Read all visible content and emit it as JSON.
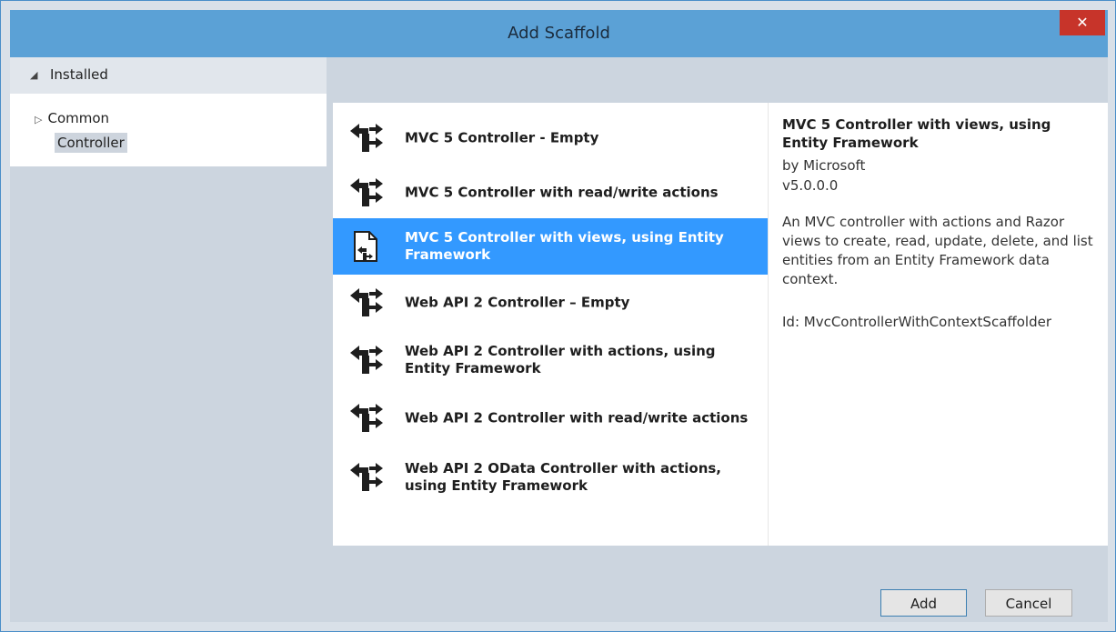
{
  "window": {
    "title": "Add Scaffold",
    "close_glyph": "✕"
  },
  "tree": {
    "header": "Installed",
    "common": "Common",
    "controller": "Controller"
  },
  "scaffolds": [
    {
      "label": "MVC 5 Controller - Empty",
      "icon": "controller-icon"
    },
    {
      "label": "MVC 5 Controller with read/write actions",
      "icon": "controller-icon"
    },
    {
      "label": "MVC 5 Controller with views, using Entity Framework",
      "icon": "controller-views-icon",
      "selected": true
    },
    {
      "label": "Web API 2 Controller – Empty",
      "icon": "controller-icon"
    },
    {
      "label": "Web API 2 Controller with actions, using Entity Framework",
      "icon": "controller-icon"
    },
    {
      "label": "Web API 2 Controller with read/write actions",
      "icon": "controller-icon"
    },
    {
      "label": "Web API 2 OData Controller with actions, using Entity Framework",
      "icon": "controller-icon"
    }
  ],
  "details": {
    "title": "MVC 5 Controller with views, using Entity Framework",
    "by": "by Microsoft",
    "version": "v5.0.0.0",
    "description": "An MVC controller with actions and Razor views to create, read, update, delete, and list entities from an Entity Framework data context.",
    "id": "Id: MvcControllerWithContextScaffolder"
  },
  "buttons": {
    "add": "Add",
    "cancel": "Cancel"
  },
  "colors": {
    "titlebar": "#5ba1d6",
    "selection": "#3399ff",
    "close": "#c7342a"
  }
}
